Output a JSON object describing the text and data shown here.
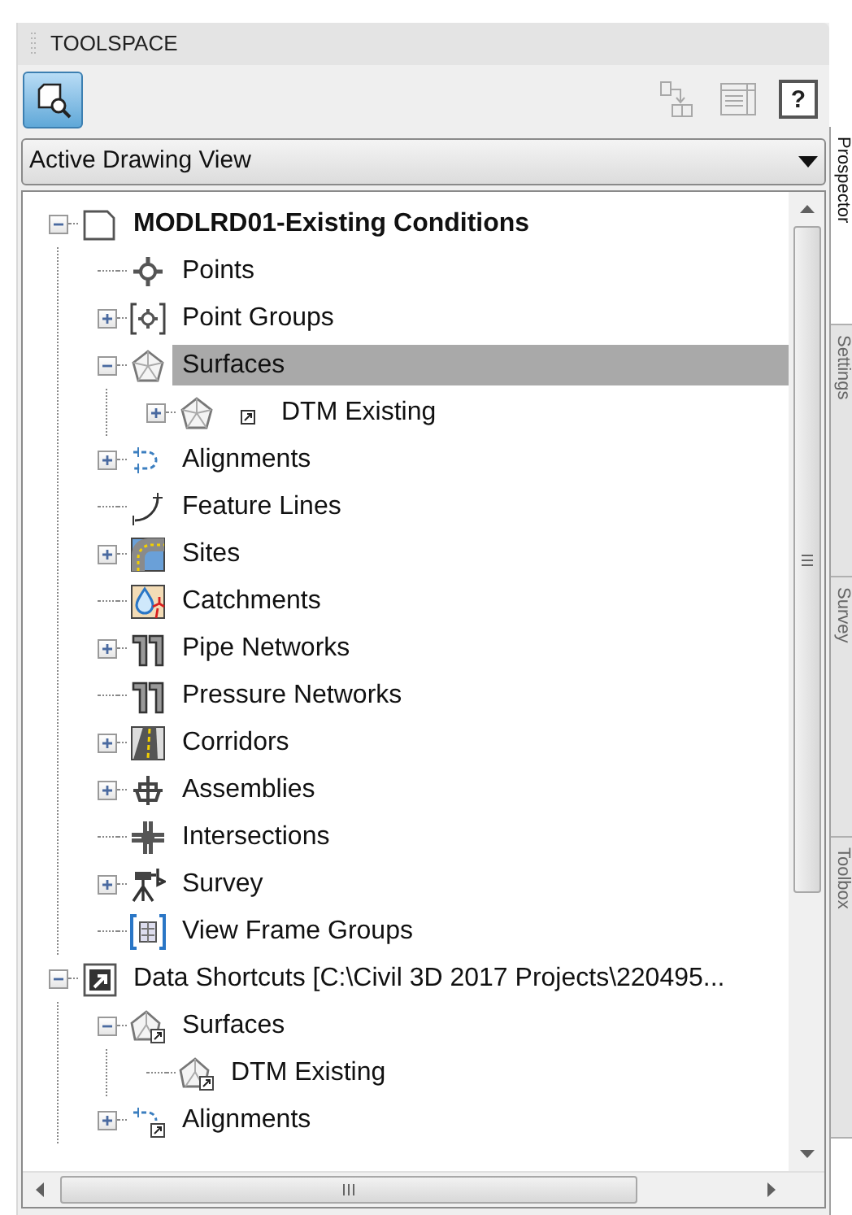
{
  "palette": {
    "title": "TOOLSPACE"
  },
  "toolbar": [
    {
      "kind": "view-toggle",
      "selected": true,
      "disabled": false
    },
    {
      "kind": "item-view",
      "selected": false,
      "disabled": true
    },
    {
      "kind": "list-view",
      "selected": false,
      "disabled": true
    },
    {
      "kind": "help",
      "label": "?",
      "disabled": false
    }
  ],
  "view_dropdown": {
    "value": "Active Drawing View"
  },
  "tree": [
    {
      "label": "MODLRD01-Existing Conditions",
      "kind": "drawing",
      "emphasized": true,
      "expandable": true,
      "expanded": true,
      "selected": false,
      "children": [
        {
          "label": "Points",
          "kind": "points",
          "selected": false
        },
        {
          "label": "Point Groups",
          "kind": "point-groups",
          "expandable": true,
          "expanded": false,
          "selected": false
        },
        {
          "label": "Surfaces",
          "kind": "surface",
          "expandable": true,
          "expanded": true,
          "selected": true,
          "children": [
            {
              "label": "DTM Existing",
              "kind": "surface",
              "referenced": true,
              "expandable": true,
              "expanded": false,
              "selected": false
            }
          ]
        },
        {
          "label": "Alignments",
          "kind": "alignment",
          "expandable": true,
          "expanded": false,
          "selected": false
        },
        {
          "label": "Feature Lines",
          "kind": "feature-line",
          "selected": false
        },
        {
          "label": "Sites",
          "kind": "site",
          "expandable": true,
          "expanded": false,
          "selected": false
        },
        {
          "label": "Catchments",
          "kind": "catchment",
          "selected": false
        },
        {
          "label": "Pipe Networks",
          "kind": "pipe",
          "expandable": true,
          "expanded": false,
          "selected": false
        },
        {
          "label": "Pressure Networks",
          "kind": "pipe",
          "selected": false
        },
        {
          "label": "Corridors",
          "kind": "corridor",
          "expandable": true,
          "expanded": false,
          "selected": false
        },
        {
          "label": "Assemblies",
          "kind": "assembly",
          "expandable": true,
          "expanded": false,
          "selected": false
        },
        {
          "label": "Intersections",
          "kind": "intersection",
          "selected": false
        },
        {
          "label": "Survey",
          "kind": "survey",
          "expandable": true,
          "expanded": false,
          "selected": false
        },
        {
          "label": "View Frame Groups",
          "kind": "view-frame",
          "selected": false
        }
      ]
    },
    {
      "label": "Data Shortcuts [C:\\Civil 3D 2017 Projects\\220495...",
      "kind": "shortcuts",
      "emphasized": false,
      "expandable": true,
      "expanded": true,
      "selected": false,
      "children": [
        {
          "label": "Surfaces",
          "kind": "surface-shortcut",
          "expandable": true,
          "expanded": true,
          "selected": false,
          "children": [
            {
              "label": "DTM Existing",
              "kind": "surface-shortcut",
              "selected": false
            }
          ]
        },
        {
          "label": "Alignments",
          "kind": "alignment-shortcut",
          "expandable": true,
          "expanded": false,
          "selected": false
        }
      ]
    }
  ],
  "side_tabs": [
    {
      "label": "Prospector",
      "selected": true
    },
    {
      "label": "Settings",
      "selected": false
    },
    {
      "label": "Survey",
      "selected": false
    },
    {
      "label": "Toolbox",
      "selected": false
    }
  ]
}
